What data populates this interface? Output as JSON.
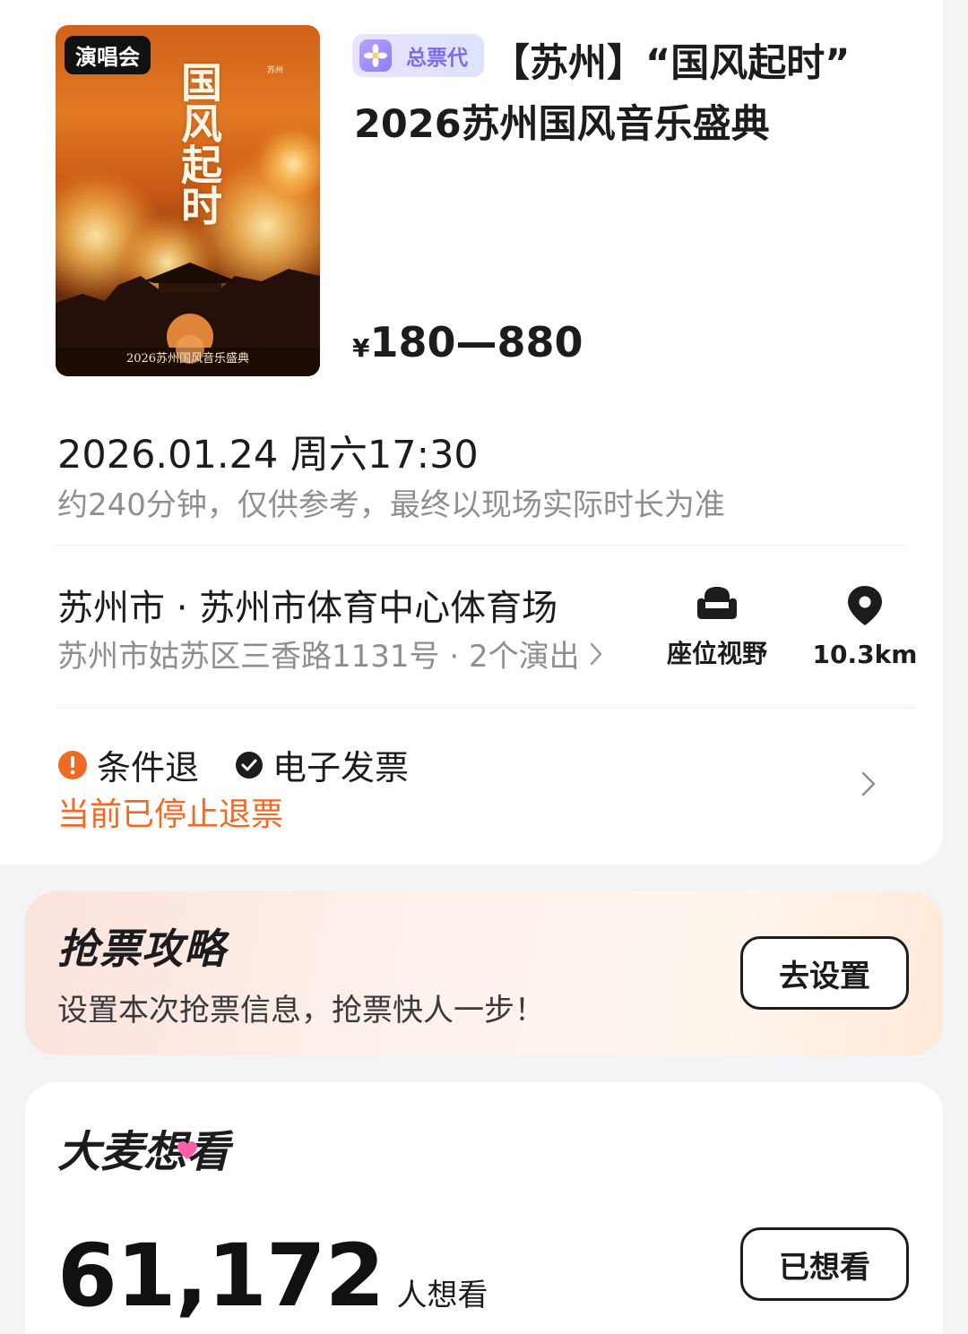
{
  "poster": {
    "tag": "演唱会",
    "calligraphy": "国风起时",
    "side_text": "苏州",
    "caption": "2026苏州国风音乐盛典"
  },
  "event": {
    "agent_badge": "总票代",
    "title_line1": "【苏州】“国风起时”",
    "title_line2": "2026苏州国风音乐盛典",
    "price_symbol": "¥",
    "price_range": "180—880"
  },
  "schedule": {
    "datetime": "2026.01.24 周六17:30",
    "duration_note": "约240分钟，仅供参考，最终以现场实际时长为准"
  },
  "venue": {
    "name": "苏州市 · 苏州市体育中心体育场",
    "address": "苏州市姑苏区三香路1131号 · 2个演出",
    "seat_view_label": "座位视野",
    "distance": "10.3km"
  },
  "policy": {
    "refund_label": "条件退",
    "invoice_label": "电子发票",
    "refund_status": "当前已停止退票",
    "warning_color": "#f06a25"
  },
  "strategy": {
    "title": "抢票攻略",
    "subtitle": "设置本次抢票信息，抢票快人一步！",
    "button": "去设置"
  },
  "wishlist": {
    "title": "大麦想看",
    "count": "61,172",
    "unit": "人想看",
    "button": "已想看",
    "heart_color": "#ff5fa8"
  }
}
